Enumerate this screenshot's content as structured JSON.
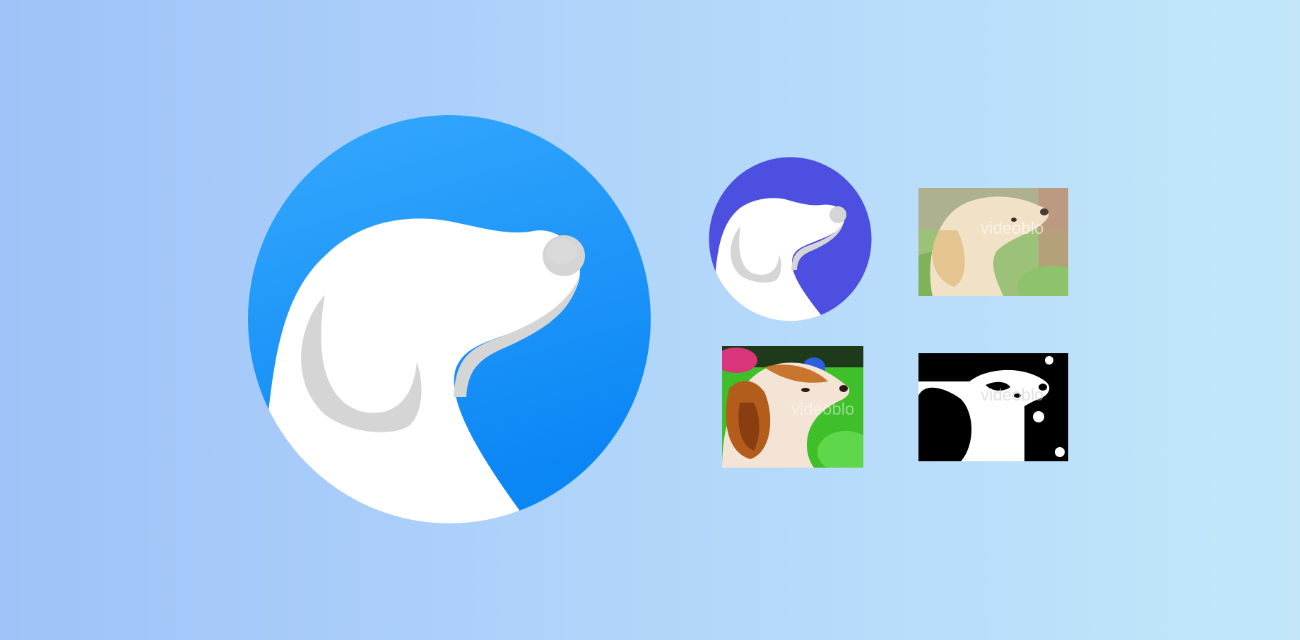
{
  "background": {
    "gradient_start": "#9fc2f8",
    "gradient_end": "#c3e7f9"
  },
  "main_logo": {
    "icon": "dog-head-logo",
    "circle_color_top": "#36a9fd",
    "circle_color_bottom": "#0b86f5",
    "head_color": "#ffffff",
    "shade_color": "#d5d5d5"
  },
  "small_logo": {
    "icon": "dog-head-logo",
    "circle_color": "#4c4fe0",
    "head_color": "#ffffff",
    "shade_color": "#d5d5d5"
  },
  "photos": [
    {
      "name": "photo-natural",
      "style": "natural",
      "watermark": "videoblo"
    },
    {
      "name": "photo-saturated",
      "style": "saturated",
      "watermark": "videoblo"
    },
    {
      "name": "photo-threshold",
      "style": "black-and-white-threshold",
      "watermark": "videoblo"
    }
  ]
}
